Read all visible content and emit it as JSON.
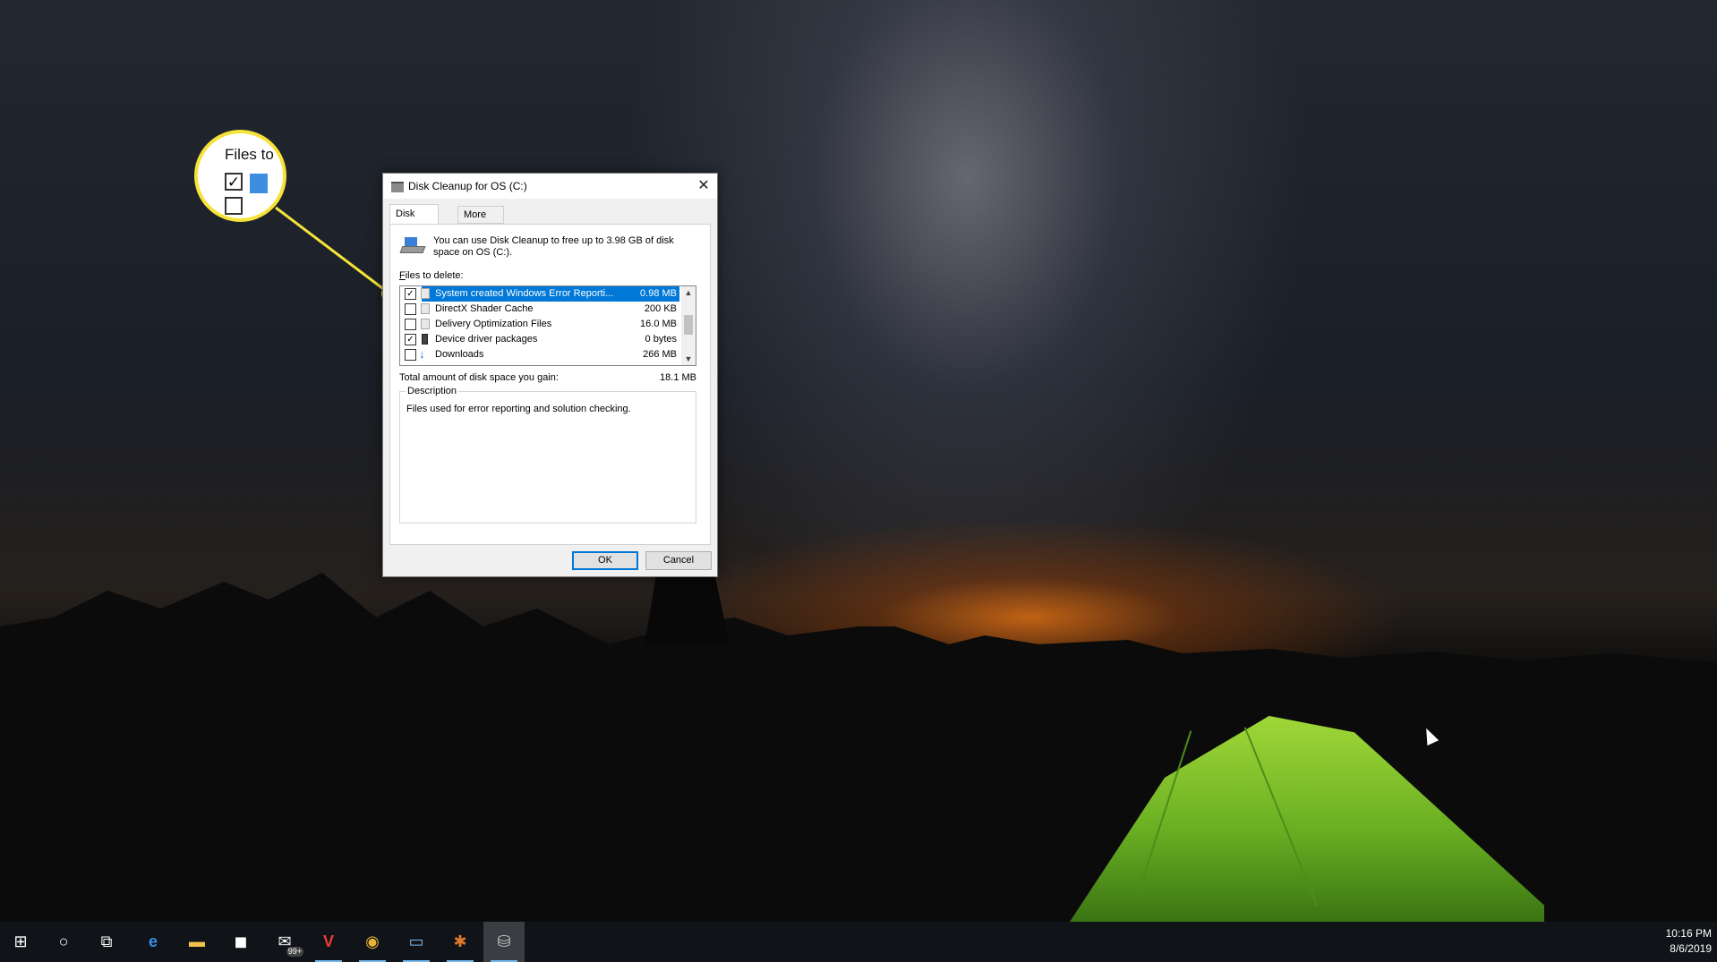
{
  "dialog": {
    "title": "Disk Cleanup for OS (C:)",
    "close_symbol": "✕",
    "tabs": [
      {
        "label": "Disk Cleanup"
      },
      {
        "label": "More Options"
      }
    ],
    "intro_text": "You can use Disk Cleanup to free up to 3.98 GB of disk space on OS (C:).",
    "files_label_underlined": "F",
    "files_label_rest": "iles to delete:",
    "files": [
      {
        "name": "System created Windows Error Reporti...",
        "size": "0.98 MB",
        "checked": true,
        "selected": true,
        "icon": "file-icon"
      },
      {
        "name": "DirectX Shader Cache",
        "size": "200 KB",
        "checked": false,
        "selected": false,
        "icon": "file-icon"
      },
      {
        "name": "Delivery Optimization Files",
        "size": "16.0 MB",
        "checked": false,
        "selected": false,
        "icon": "file-icon"
      },
      {
        "name": "Device driver packages",
        "size": "0 bytes",
        "checked": true,
        "selected": false,
        "icon": "driver-icon"
      },
      {
        "name": "Downloads",
        "size": "266 MB",
        "checked": false,
        "selected": false,
        "icon": "download-arrow-icon"
      }
    ],
    "total_label": "Total amount of disk space you gain:",
    "total_value": "18.1 MB",
    "description_legend": "Description",
    "description_text": "Files used for error reporting and solution checking.",
    "ok_label": "OK",
    "cancel_label": "Cancel"
  },
  "callout": {
    "title": "Files to",
    "checked_symbol": "✓",
    "accent_color": "#f5e33a"
  },
  "taskbar": {
    "items": [
      {
        "name": "start-windows-icon",
        "glyph": "⊞"
      },
      {
        "name": "cortana-search-icon",
        "glyph": "○"
      },
      {
        "name": "task-view-icon",
        "glyph": "⧉"
      },
      {
        "name": "edge-browser-icon",
        "glyph": "e"
      },
      {
        "name": "file-explorer-icon",
        "glyph": "▬"
      },
      {
        "name": "store-icon",
        "glyph": "◼"
      },
      {
        "name": "mail-icon",
        "glyph": "✉",
        "badge": "99+"
      },
      {
        "name": "vivaldi-icon",
        "glyph": "V"
      },
      {
        "name": "chrome-icon",
        "glyph": "◉"
      },
      {
        "name": "remote-desktop-icon",
        "glyph": "▭"
      },
      {
        "name": "app-icon",
        "glyph": "✱"
      },
      {
        "name": "disk-cleanup-icon",
        "glyph": "⛁"
      }
    ],
    "time": "10:16 PM",
    "date": "8/6/2019"
  }
}
